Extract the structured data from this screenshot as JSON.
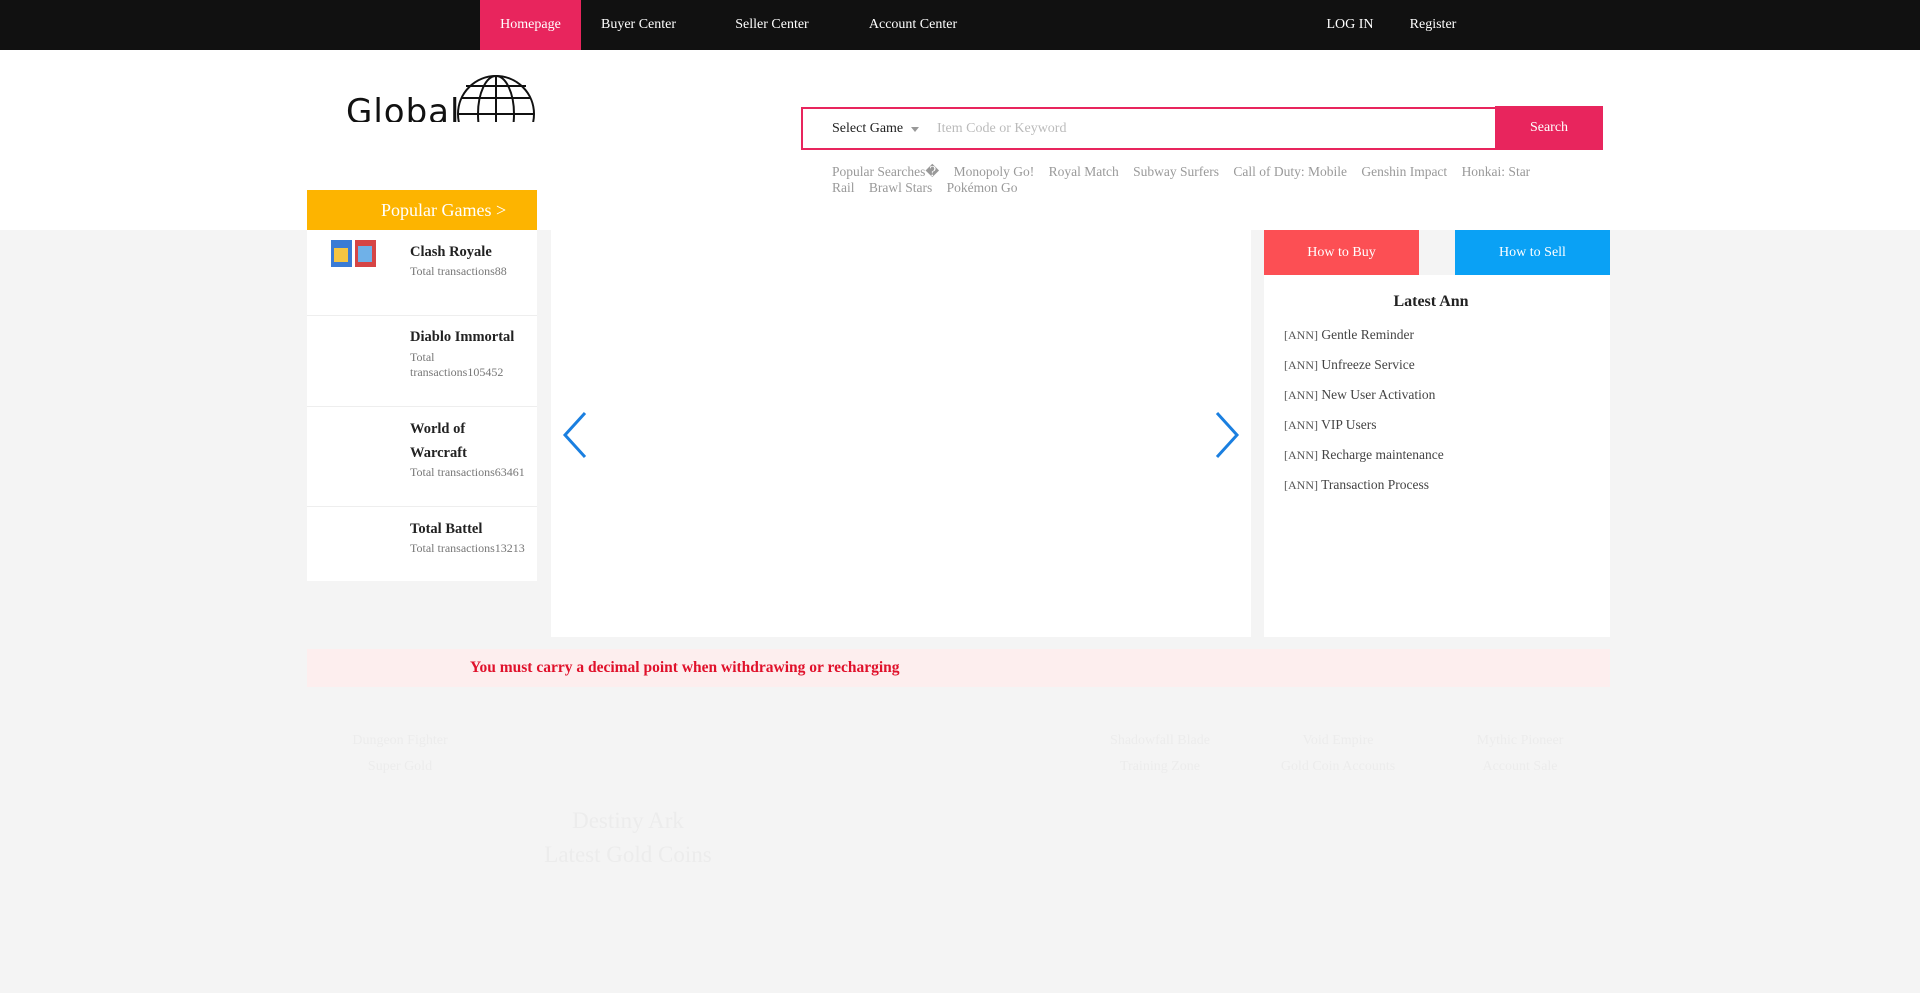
{
  "nav": {
    "items": [
      {
        "label": "Homepage",
        "active": true
      },
      {
        "label": "Buyer Center"
      },
      {
        "label": "Seller Center"
      },
      {
        "label": "Account Center"
      }
    ],
    "login": "LOG IN",
    "register": "Register"
  },
  "logo": {
    "text": "Global"
  },
  "search": {
    "select_label": "Select Game",
    "placeholder": "Item Code or Keyword",
    "button": "Search"
  },
  "popular_searches": {
    "label": "Popular Searches",
    "items": [
      "Monopoly Go!",
      "Royal Match",
      "Subway Surfers",
      "Call of Duty: Mobile",
      "Genshin Impact",
      "Honkai: Star Rail",
      "Brawl Stars",
      "Pokémon Go"
    ]
  },
  "popular_games": {
    "title": "Popular Games >",
    "items": [
      {
        "name": "Clash Royale",
        "transactions": "Total transactions88"
      },
      {
        "name": "Diablo Immortal",
        "transactions_line1": "Total",
        "transactions_line2": "transactions105452"
      },
      {
        "name_line1": "World of",
        "name_line2": "Warcraft",
        "transactions": "Total transactions63461"
      },
      {
        "name": "Total Battel",
        "transactions": "Total transactions13213"
      }
    ]
  },
  "actions": {
    "how_to_buy": "How to Buy",
    "how_to_sell": "How to Sell"
  },
  "announcements": {
    "title": "Latest Ann",
    "tag": "[ANN]",
    "items": [
      "Gentle Reminder",
      "Unfreeze Service",
      "New User Activation",
      "VIP Users",
      "Recharge maintenance",
      "Transaction Process"
    ]
  },
  "notice": "You must carry a decimal point when withdrawing or recharging",
  "footer_faint": {
    "a1": "Dungeon Fighter",
    "a2": "Super Gold",
    "b1": "Destiny Ark",
    "b2": "Latest Gold Coins",
    "c1": "Shadowfall Blade",
    "c2": "Training Zone",
    "d1": "Void Empire",
    "d2": "Gold Coin Accounts",
    "e1": "Mythic Pioneer",
    "e2": "Account Sale"
  },
  "colors": {
    "accent": "#e8255d",
    "topbar": "#111111",
    "popular_games": "#fdb400",
    "how_to_buy": "#fc4f54",
    "how_to_sell": "#0aa1f5",
    "notice_text": "#e0112b",
    "arrow": "#1a7fe0"
  },
  "icons": {
    "globe": "globe-icon",
    "prev": "chevron-left-icon",
    "next": "chevron-right-icon",
    "select_caret": "caret-down-icon"
  }
}
